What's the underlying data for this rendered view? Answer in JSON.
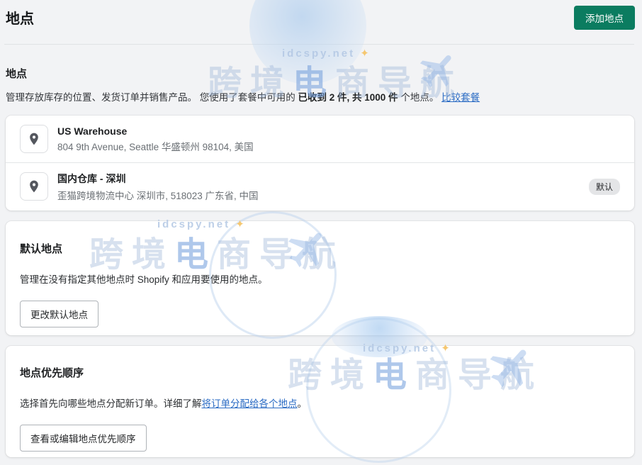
{
  "page": {
    "title": "地点"
  },
  "header": {
    "add_button": "添加地点"
  },
  "section": {
    "heading": "地点",
    "desc_1": "管理存放库存的位置、发货订单并销售产品。 您使用了套餐中可用的 ",
    "desc_bold": "已收到 2 件, 共 1000 件",
    "desc_2": " 个地点。 ",
    "compare_link": "比较套餐"
  },
  "locations": [
    {
      "name": "US Warehouse",
      "address": "804 9th Avenue, Seattle 华盛顿州 98104, 美国",
      "badge": ""
    },
    {
      "name": "国内仓库 - 深圳",
      "address": "歪猫跨境物流中心 深圳市, 518023 广东省, 中国",
      "badge": "默认"
    }
  ],
  "default_location": {
    "heading": "默认地点",
    "body": "管理在没有指定其他地点时 Shopify 和应用要使用的地点。",
    "button": "更改默认地点"
  },
  "priority": {
    "heading": "地点优先顺序",
    "body_1": "选择首先向哪些地点分配新订单。详细了解",
    "link": "将订单分配给各个地点",
    "body_2": "。",
    "button": "查看或编辑地点优先顺序"
  },
  "watermark": {
    "site": "idcspy.net",
    "sparkle": "✦",
    "big_pre": "跨境",
    "big_hl": "电",
    "big_post": "商导航"
  },
  "colors": {
    "primary_green": "#0b7c60",
    "link_blue": "#2a6bc4",
    "badge_gray": "#e4e5e7"
  }
}
